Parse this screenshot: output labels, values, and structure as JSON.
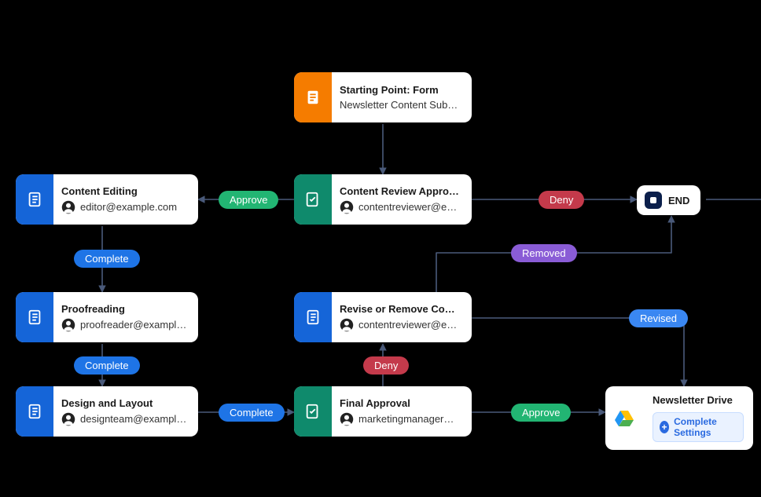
{
  "nodes": {
    "start": {
      "title": "Starting Point: Form",
      "subtitle": "Newsletter Content Submi..."
    },
    "contentReview": {
      "title": "Content Review Approval",
      "assignee": "contentreviewer@exa..."
    },
    "contentEditing": {
      "title": "Content Editing",
      "assignee": "editor@example.com"
    },
    "proofreading": {
      "title": "Proofreading",
      "assignee": "proofreader@example..."
    },
    "designLayout": {
      "title": "Design and Layout",
      "assignee": "designteam@example..."
    },
    "reviseRemove": {
      "title": "Revise or Remove Content",
      "assignee": "contentreviewer@exa..."
    },
    "finalApproval": {
      "title": "Final Approval",
      "assignee": "marketingmanager@e..."
    },
    "end": {
      "label": "END"
    },
    "drive": {
      "title": "Newsletter Drive",
      "button": "Complete Settings"
    }
  },
  "edges": {
    "approve1": "Approve",
    "deny1": "Deny",
    "complete1": "Complete",
    "complete2": "Complete",
    "complete3": "Complete",
    "deny2": "Deny",
    "approve2": "Approve",
    "removed": "Removed",
    "revised": "Revised"
  }
}
